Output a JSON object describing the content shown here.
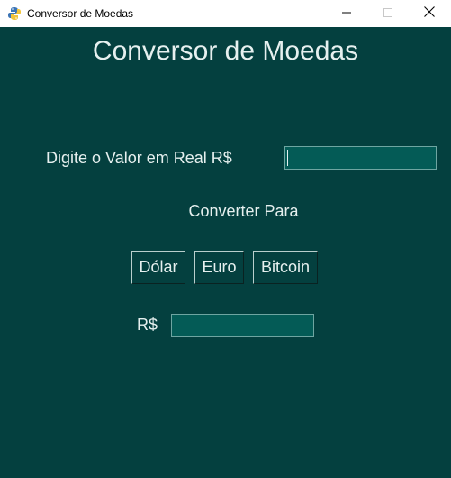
{
  "window": {
    "title": "Conversor de Moedas",
    "icon": "python-feather-icon",
    "controls": {
      "minimize_icon": "minimize-icon",
      "maximize_icon": "maximize-icon",
      "close_icon": "close-icon"
    }
  },
  "app": {
    "heading": "Conversor de Moedas",
    "input_label": "Digite o Valor em Real R$",
    "input_value": "",
    "convert_label": "Converter Para",
    "buttons": {
      "dolar": "Dólar",
      "euro": "Euro",
      "bitcoin": "Bitcoin"
    },
    "result_label": "R$",
    "result_value": ""
  },
  "colors": {
    "background": "#04403f",
    "entry_background": "#045b56",
    "text": "#e6f0ef"
  }
}
